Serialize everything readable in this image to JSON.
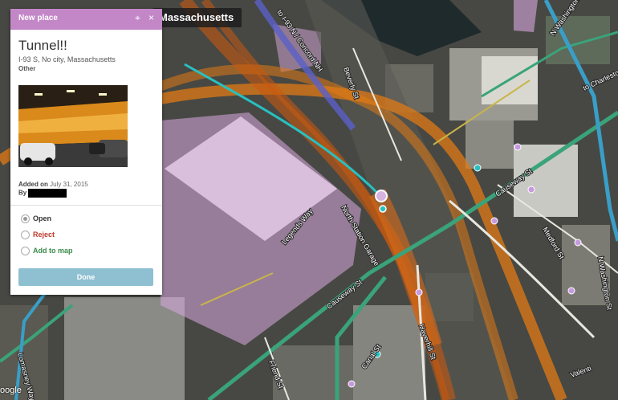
{
  "map": {
    "location_banner": "Massachusetts",
    "street_labels": {
      "concord": "to I-93 N / Concord NH",
      "beverly": "Beverly St",
      "charlestown": "to Charlestow",
      "washington_top": "N Washington St",
      "washington_right": "N Washington St",
      "causeway_right": "Causeway St",
      "causeway_left": "Causeway St",
      "north_station": "North Station Garage",
      "legends": "Legends Way",
      "medford": "Medford St",
      "haverhill": "Haverhill St",
      "canal": "Canal St",
      "friend": "Friend St",
      "lomasney": "Lomasney Way",
      "valenti": "Valenti"
    },
    "google_logo": "oogle"
  },
  "panel": {
    "header_title": "New place",
    "place_name": "Tunnel!!",
    "address": "I-93 S, No city, Massachusetts",
    "category": "Other",
    "added_label": "Added on",
    "added_date": "July 31, 2015",
    "by_label": "By",
    "options": {
      "open": "Open",
      "reject": "Reject",
      "add": "Add to map"
    },
    "done_label": "Done"
  },
  "colors": {
    "header": "#c387c8",
    "reject": "#c0392b",
    "add_to_map": "#3a8a4a",
    "done": "#8ec0d2",
    "route_orange": "#e07a14",
    "road_green": "#3aa37a",
    "road_blue": "#3a9ec7"
  }
}
